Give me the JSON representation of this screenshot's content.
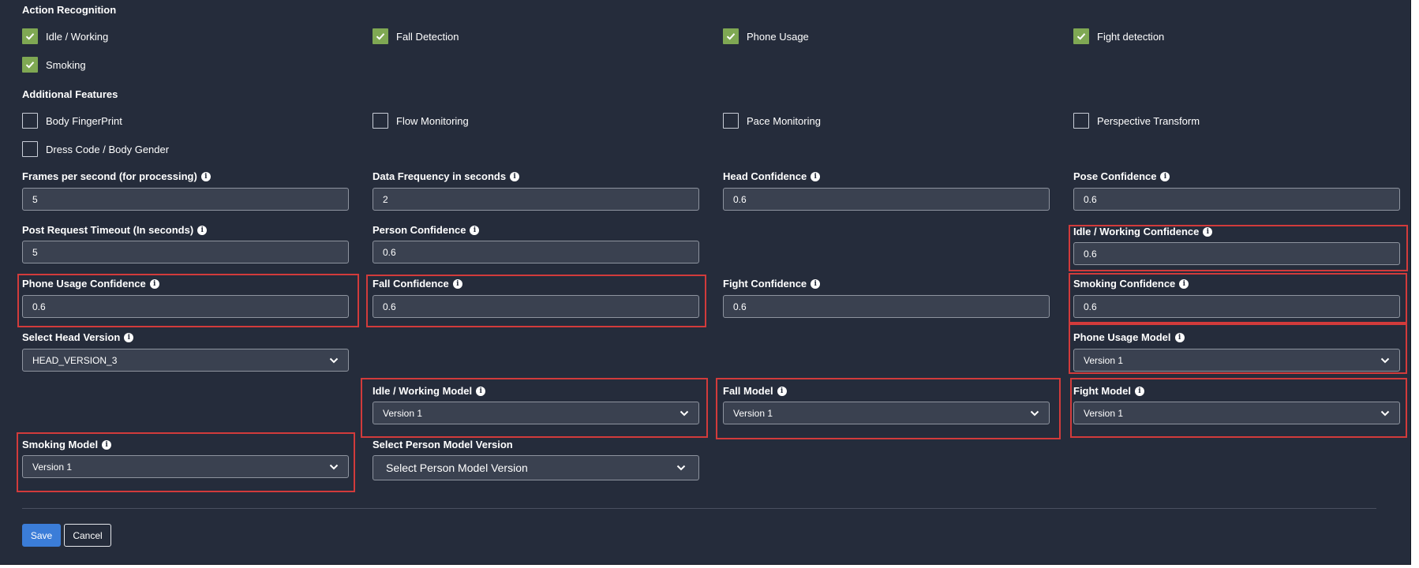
{
  "action_recognition": {
    "title": "Action Recognition",
    "items": [
      {
        "label": "Idle / Working",
        "checked": true
      },
      {
        "label": "Fall Detection",
        "checked": true
      },
      {
        "label": "Phone Usage",
        "checked": true
      },
      {
        "label": "Fight detection",
        "checked": true
      },
      {
        "label": "Smoking",
        "checked": true
      }
    ]
  },
  "additional_features": {
    "title": "Additional Features",
    "items": [
      {
        "label": "Body FingerPrint",
        "checked": false
      },
      {
        "label": "Flow Monitoring",
        "checked": false
      },
      {
        "label": "Pace Monitoring",
        "checked": false
      },
      {
        "label": "Perspective Transform",
        "checked": false
      },
      {
        "label": "Dress Code / Body Gender",
        "checked": false
      }
    ]
  },
  "fields": {
    "fps": {
      "label": "Frames per second (for processing)",
      "value": "5"
    },
    "data_frequency": {
      "label": "Data Frequency in seconds",
      "value": "2"
    },
    "head_confidence": {
      "label": "Head Confidence",
      "value": "0.6"
    },
    "pose_confidence": {
      "label": "Pose Confidence",
      "value": "0.6"
    },
    "post_timeout": {
      "label": "Post Request Timeout (In seconds)",
      "value": "5"
    },
    "person_confidence": {
      "label": "Person Confidence",
      "value": "0.6"
    },
    "idle_confidence": {
      "label": "Idle / Working Confidence",
      "value": "0.6"
    },
    "phone_confidence": {
      "label": "Phone Usage Confidence",
      "value": "0.6"
    },
    "fall_confidence": {
      "label": "Fall Confidence",
      "value": "0.6"
    },
    "fight_confidence": {
      "label": "Fight Confidence",
      "value": "0.6"
    },
    "smoking_confidence": {
      "label": "Smoking Confidence",
      "value": "0.6"
    }
  },
  "selects": {
    "head_version": {
      "label": "Select Head Version",
      "value": "HEAD_VERSION_3"
    },
    "phone_model": {
      "label": "Phone Usage Model",
      "value": "Version 1"
    },
    "idle_model": {
      "label": "Idle / Working Model",
      "value": "Version 1"
    },
    "fall_model": {
      "label": "Fall Model",
      "value": "Version 1"
    },
    "fight_model": {
      "label": "Fight Model",
      "value": "Version 1"
    },
    "smoking_model": {
      "label": "Smoking Model",
      "value": "Version 1"
    },
    "person_model": {
      "label": "Select Person Model Version",
      "value": "Select Person Model Version"
    }
  },
  "buttons": {
    "save": "Save",
    "cancel": "Cancel"
  },
  "colors": {
    "background": "#252c3b",
    "checkbox_checked": "#7fa853",
    "highlight": "#d23b3b",
    "save_button": "#3b7dd8"
  }
}
